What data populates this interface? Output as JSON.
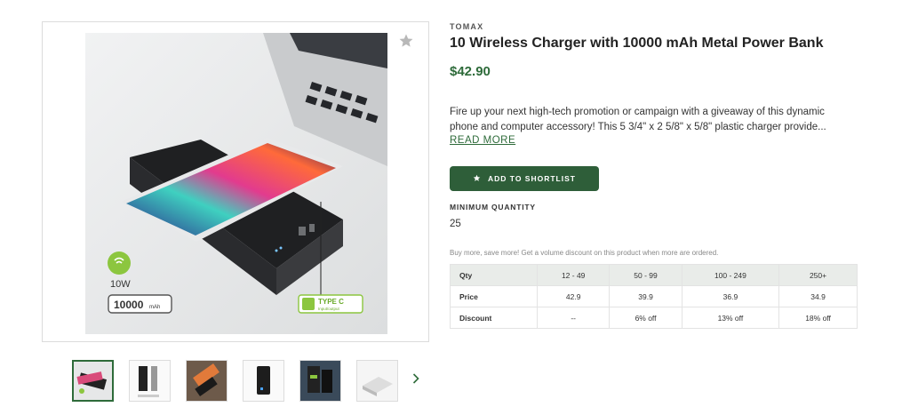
{
  "product": {
    "brand": "TOMAX",
    "title": "10 Wireless Charger with 10000 mAh Metal Power Bank",
    "price": "$42.90",
    "description_line1": "Fire up your next high-tech promotion or campaign with a giveaway of this dynamic",
    "description_line2": "phone and computer accessory! This 5 3/4\" x 2 5/8\" x 5/8\" plastic charger provide...",
    "read_more": "READ MORE",
    "shortlist_label": "ADD TO SHORTLIST",
    "min_qty_label": "MINIMUM QUANTITY",
    "min_qty_value": "25",
    "volume_note": "Buy more, save more! Get a volume discount on this product when more are ordered."
  },
  "image": {
    "badge_power": "10W",
    "badge_capacity": "10000",
    "badge_capacity_unit": "mAh",
    "badge_port": "TYPE C",
    "badge_port_sub": "Input/output"
  },
  "pricing_table": {
    "header": [
      "Qty",
      "12 - 49",
      "50 - 99",
      "100 - 249",
      "250+"
    ],
    "rows": [
      [
        "Price",
        "42.9",
        "39.9",
        "36.9",
        "34.9"
      ],
      [
        "Discount",
        "--",
        "6% off",
        "13% off",
        "18% off"
      ]
    ]
  },
  "thumbnails": [
    "thumb-1",
    "thumb-2",
    "thumb-3",
    "thumb-4",
    "thumb-5",
    "thumb-6"
  ],
  "colors": {
    "accent": "#2e6b3a",
    "button": "#2e5e39",
    "table_header": "#e9ece9"
  },
  "icons": {
    "favorite": "star-icon",
    "button": "star-icon",
    "next": "chevron-right-icon"
  }
}
